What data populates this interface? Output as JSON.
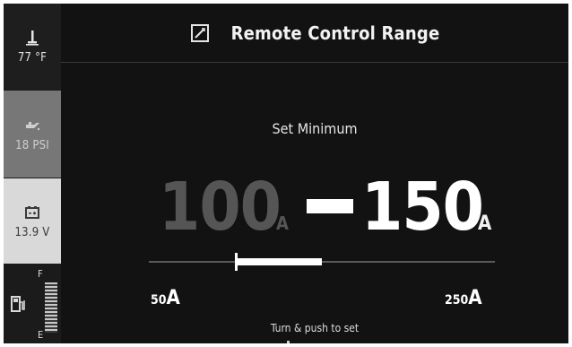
{
  "sidebar": {
    "temperature": {
      "icon": "thermometer-icon",
      "value": "77 °F"
    },
    "oil_pressure": {
      "icon": "oil-can-icon",
      "value": "18 PSI"
    },
    "battery": {
      "icon": "battery-icon",
      "value": "13.9 V"
    },
    "fuel": {
      "icon": "fuel-pump-icon",
      "full_label": "F",
      "empty_label": "E"
    }
  },
  "header": {
    "icon": "edit-icon",
    "title": "Remote Control Range"
  },
  "range": {
    "subtitle": "Set Minimum",
    "min_value": "100",
    "min_unit": "A",
    "max_value": "150",
    "max_unit": "A",
    "scale_min_value": 50,
    "scale_max_value": 250,
    "scale_min_label": "50",
    "scale_max_label": "250",
    "scale_unit": "A"
  },
  "hint": "Turn & push to set",
  "colors": {
    "background": "#121212",
    "active": "#ffffff",
    "inactive": "#555555"
  }
}
